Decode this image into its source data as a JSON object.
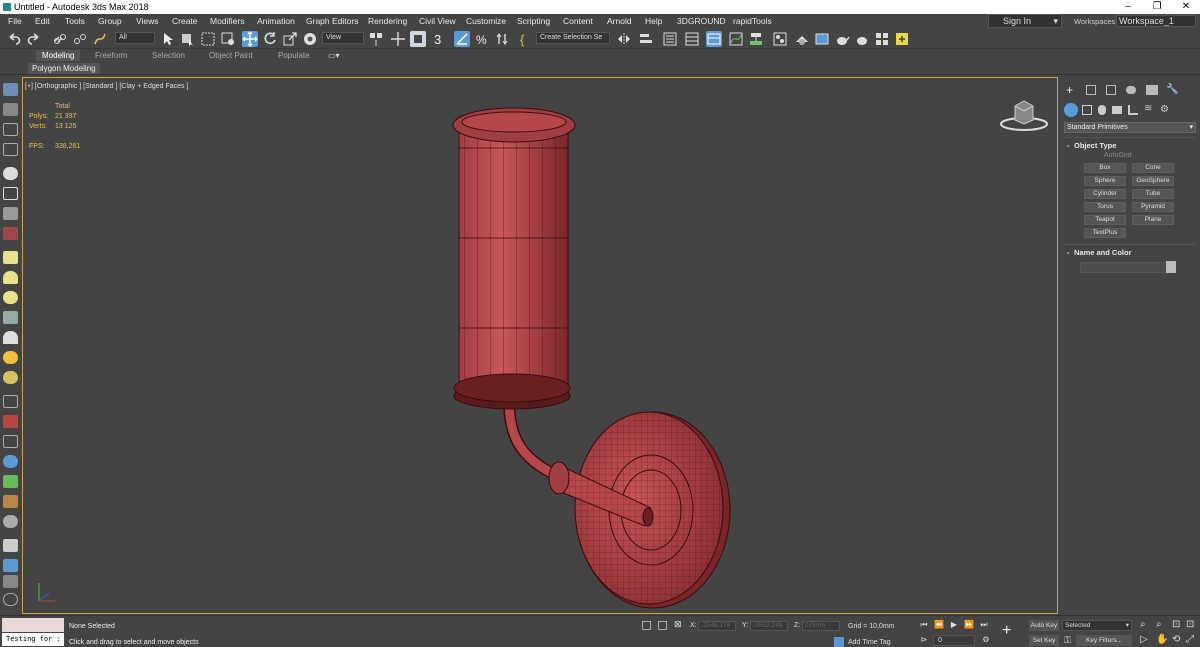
{
  "window": {
    "title": "Untitled - Autodesk 3ds Max 2018",
    "minimize": "–",
    "maximize": "❐",
    "close": "✕"
  },
  "menu": [
    "File",
    "Edit",
    "Tools",
    "Group",
    "Views",
    "Create",
    "Modifiers",
    "Animation",
    "Graph Editors",
    "Rendering",
    "Civil View",
    "Customize",
    "Scripting",
    "Content",
    "Arnold",
    "Help",
    "3DGROUND",
    "rapidTools"
  ],
  "account": {
    "signin": "Sign In",
    "workspaces_label": "Workspaces:",
    "workspace": "Workspace_1"
  },
  "toolbar": {
    "filter": "All",
    "refcoord": "View",
    "selection_set": "Create Selection Se"
  },
  "ribbon": {
    "tabs": [
      "Modeling",
      "Freeform",
      "Selection",
      "Object Paint",
      "Populate"
    ],
    "sub": "Polygon Modeling"
  },
  "viewport": {
    "label": "[+] [Orthographic ] [Standard ] [Clay + Edged Faces ]",
    "stats": {
      "total": "Total",
      "polys_label": "Polys:",
      "polys": "21 397",
      "verts_label": "Verts:",
      "verts": "13 125",
      "fps_label": "FPS:",
      "fps": "338,261"
    }
  },
  "command_panel": {
    "category": "Standard Primitives",
    "object_type": "Object Type",
    "autogrid": "AutoGrid",
    "buttons": [
      "Box",
      "Cone",
      "Sphere",
      "GeoSphere",
      "Cylinder",
      "Tube",
      "Torus",
      "Pyramid",
      "Teapot",
      "Plane",
      "TextPlus"
    ],
    "name_and_color": "Name and Color",
    "color_swatch": "#bbbbbb"
  },
  "status": {
    "maxscript": "Testing for :",
    "selection": "None Selected",
    "prompt": "Click and drag to select and move objects",
    "x_label": "X:",
    "x": "-2546,179",
    "y_label": "Y:",
    "y": "-3552,249",
    "z_label": "Z:",
    "z": "0,0mm",
    "grid": "Grid = 10,0mm",
    "add_time_tag": "Add Time Tag",
    "frame": "0",
    "auto_key": "Auto Key",
    "set_key": "Set Key",
    "selected": "Selected",
    "key_filters": "Key Filters..."
  },
  "colors": {
    "model_fill": "#b5474a",
    "model_edge": "#3a0d0e",
    "viewport_border": "#c7a43b",
    "stats_text": "#e6c14a",
    "active_button": "#5b9bd5"
  }
}
